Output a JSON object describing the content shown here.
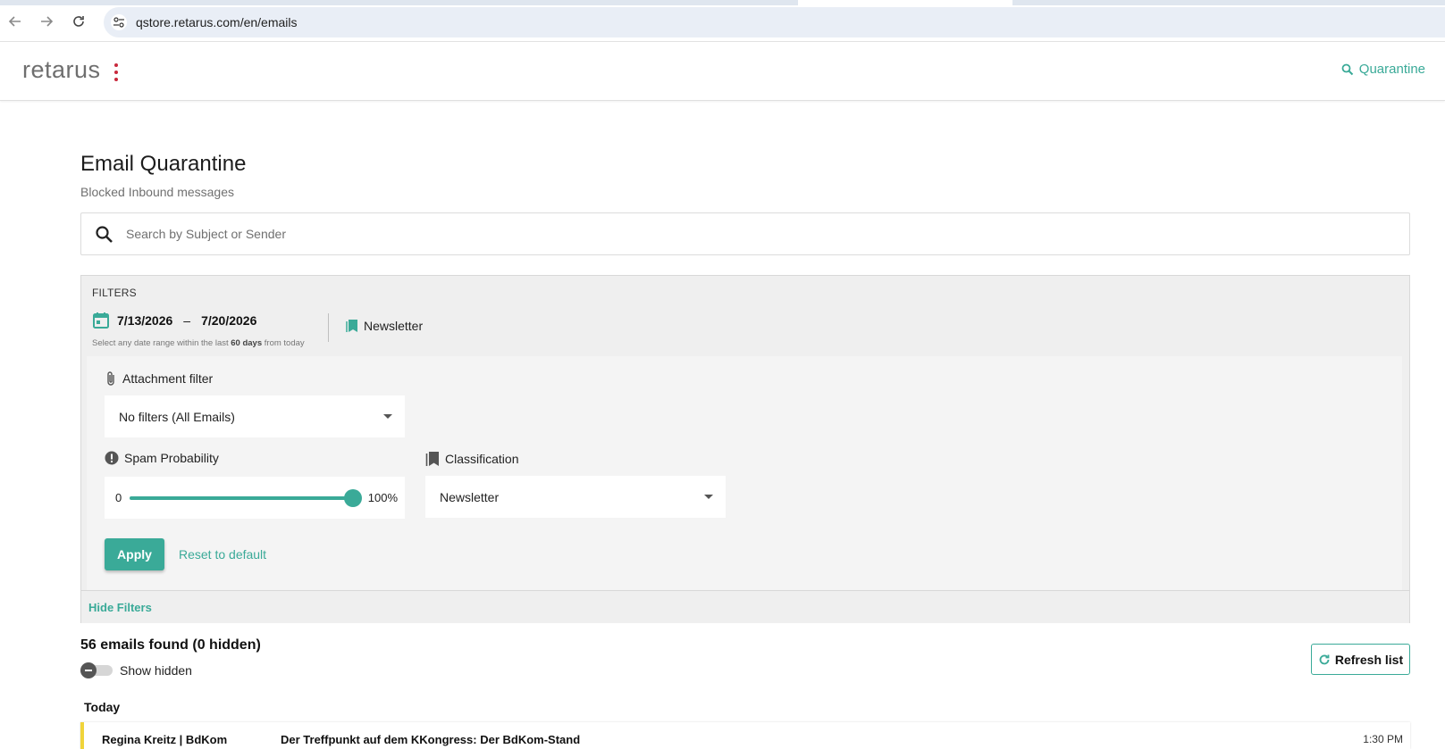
{
  "browser": {
    "url": "qstore.retarus.com/en/emails"
  },
  "header": {
    "logo_text": "retarus",
    "nav_quarantine": "Quarantine"
  },
  "page": {
    "title": "Email Quarantine",
    "subtitle": "Blocked Inbound messages"
  },
  "search": {
    "placeholder": "Search by Subject or Sender",
    "value": ""
  },
  "filters": {
    "label": "FILTERS",
    "date_from": "7/13/2026",
    "date_separator": "–",
    "date_to": "7/20/2026",
    "date_hint_prefix": "Select any date range within the last",
    "date_hint_bold": "60 days",
    "date_hint_suffix": "from today",
    "active_chip": "Newsletter",
    "attachment": {
      "label": "Attachment filter",
      "selected": "No filters (All Emails)"
    },
    "spam": {
      "label": "Spam Probability",
      "min_label": "0",
      "max_label": "100%",
      "value_fraction": 1.0
    },
    "classification": {
      "label": "Classification",
      "selected": "Newsletter"
    },
    "apply_label": "Apply",
    "reset_label": "Reset to default",
    "hide_label": "Hide Filters"
  },
  "results": {
    "summary": "56 emails found (0 hidden)",
    "show_hidden_label": "Show hidden",
    "refresh_label": "Refresh list"
  },
  "email_groups": [
    {
      "label": "Today",
      "emails": [
        {
          "sender": "Regina Kreitz | BdKom",
          "subject": "Der Treffpunkt auf dem KKongress: Der BdKom-Stand",
          "time": "1:30 PM"
        }
      ]
    }
  ],
  "colors": {
    "accent": "#3aaa98",
    "logo_dots": "#c8283c",
    "row_marker": "#f0d43a"
  }
}
